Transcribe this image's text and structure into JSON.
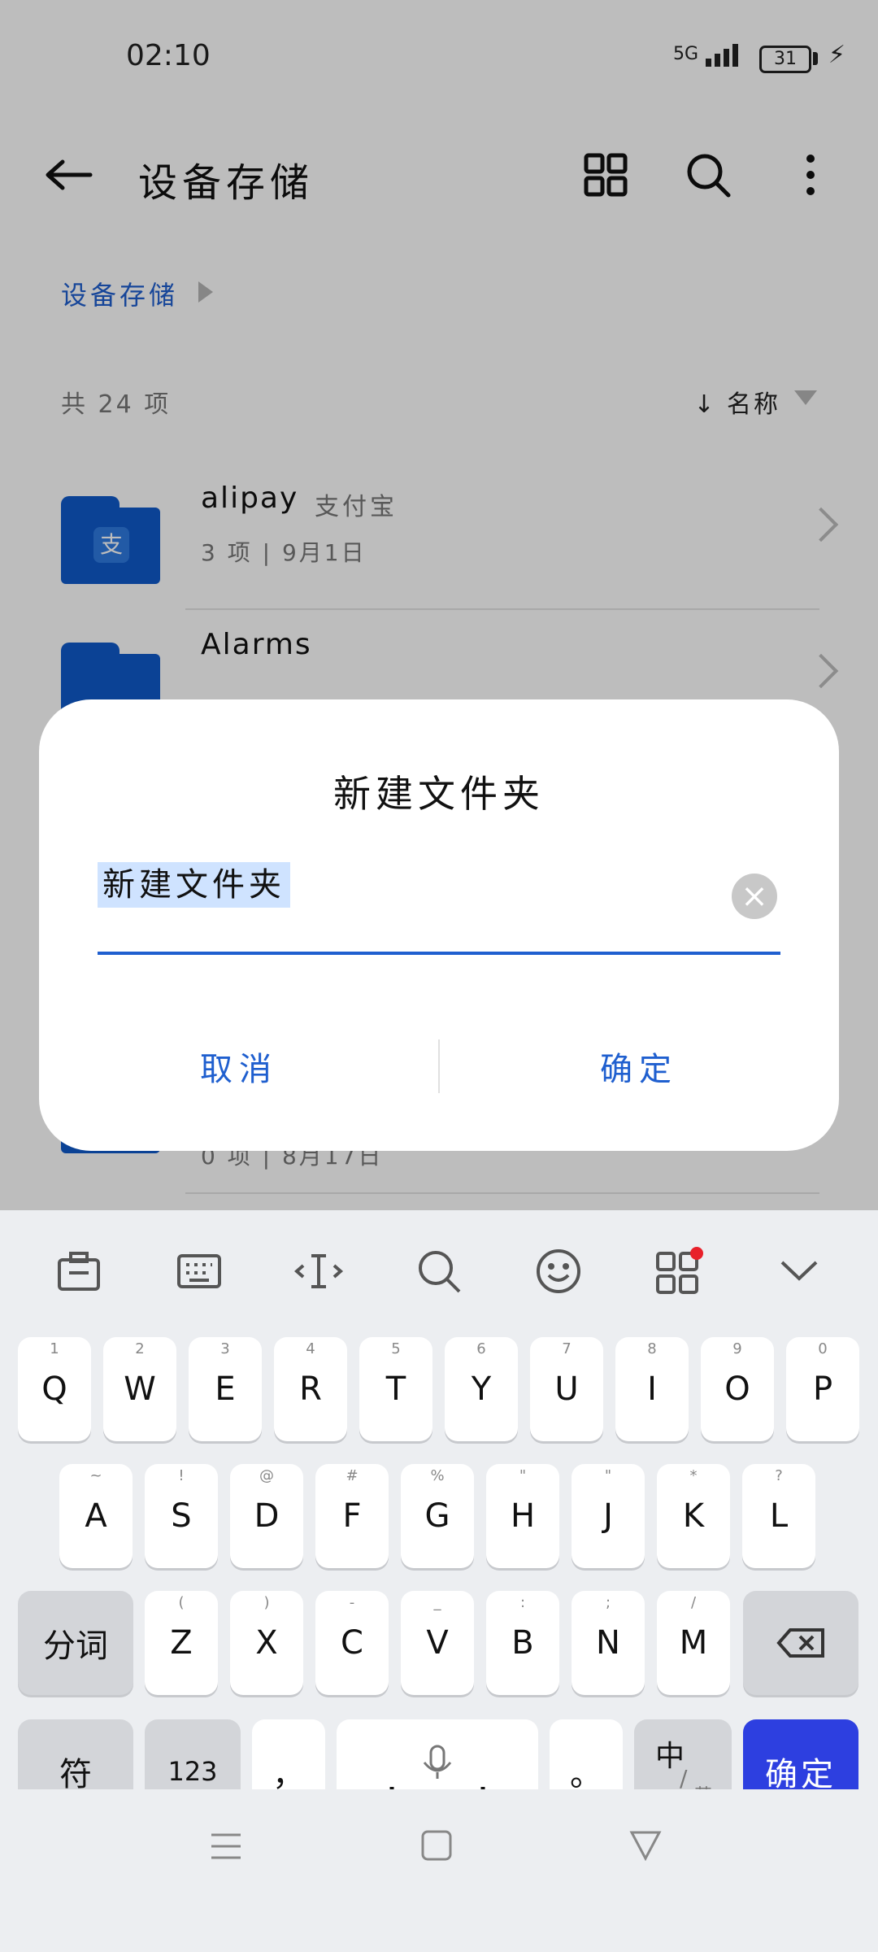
{
  "status": {
    "time": "02:10",
    "network": "5G",
    "battery": "31"
  },
  "header": {
    "title": "设备存储"
  },
  "breadcrumb": {
    "label": "设备存储"
  },
  "list": {
    "count": "共 24 项",
    "sort_label": "名称",
    "items": [
      {
        "name": "alipay",
        "sub": "支付宝",
        "meta": "3 项 | 9月1日",
        "badge": "支"
      },
      {
        "name": "Alarms",
        "sub": "",
        "meta": ""
      },
      {
        "name": "",
        "sub": "",
        "meta": "0 项 | 8月17日"
      }
    ]
  },
  "dialog": {
    "title": "新建文件夹",
    "input_value": "新建文件夹",
    "cancel": "取消",
    "confirm": "确定"
  },
  "keyboard": {
    "row1": [
      {
        "k": "Q",
        "h": "1"
      },
      {
        "k": "W",
        "h": "2"
      },
      {
        "k": "E",
        "h": "3"
      },
      {
        "k": "R",
        "h": "4"
      },
      {
        "k": "T",
        "h": "5"
      },
      {
        "k": "Y",
        "h": "6"
      },
      {
        "k": "U",
        "h": "7"
      },
      {
        "k": "I",
        "h": "8"
      },
      {
        "k": "O",
        "h": "9"
      },
      {
        "k": "P",
        "h": "0"
      }
    ],
    "row2": [
      {
        "k": "A",
        "h": "~"
      },
      {
        "k": "S",
        "h": "!"
      },
      {
        "k": "D",
        "h": "@"
      },
      {
        "k": "F",
        "h": "#"
      },
      {
        "k": "G",
        "h": "%"
      },
      {
        "k": "H",
        "h": "\""
      },
      {
        "k": "J",
        "h": "\""
      },
      {
        "k": "K",
        "h": "*"
      },
      {
        "k": "L",
        "h": "?"
      }
    ],
    "row3": [
      {
        "k": "Z",
        "h": "("
      },
      {
        "k": "X",
        "h": ")"
      },
      {
        "k": "C",
        "h": "-"
      },
      {
        "k": "V",
        "h": "_"
      },
      {
        "k": "B",
        "h": ":"
      },
      {
        "k": "N",
        "h": ";"
      },
      {
        "k": "M",
        "h": "/"
      }
    ],
    "segment": "分词",
    "symbols": "符",
    "numbers": "123",
    "comma": "，",
    "period": "。",
    "lang_main": "中",
    "lang_alt": "英",
    "enter": "确定"
  }
}
